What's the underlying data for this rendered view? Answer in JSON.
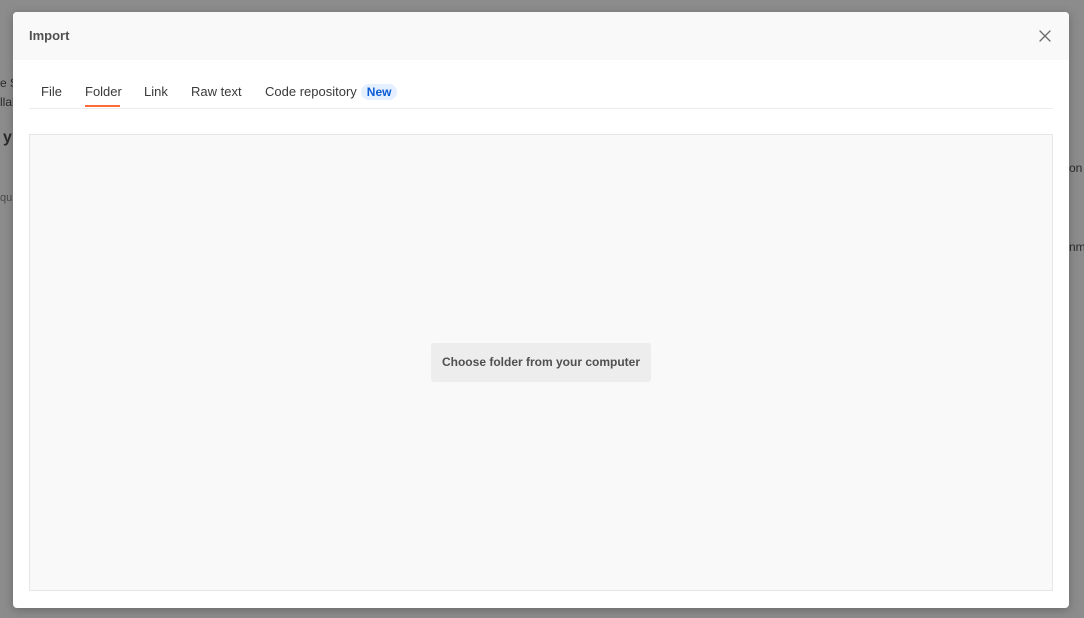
{
  "background": {
    "fragments": [
      "e S",
      "llab",
      "y",
      "qu",
      "on",
      "nm"
    ]
  },
  "modal": {
    "title": "Import",
    "close_icon": "close-icon"
  },
  "tabs": {
    "items": [
      {
        "label": "File",
        "active": false
      },
      {
        "label": "Folder",
        "active": true
      },
      {
        "label": "Link",
        "active": false
      },
      {
        "label": "Raw text",
        "active": false
      },
      {
        "label": "Code repository",
        "active": false,
        "badge": "New"
      }
    ]
  },
  "dropzone": {
    "button_label": "Choose folder from your computer"
  },
  "colors": {
    "accent": "#ff6c37",
    "badge_bg": "#e4efff",
    "badge_text": "#0b5cd5",
    "overlay": "#8c8c8c"
  }
}
